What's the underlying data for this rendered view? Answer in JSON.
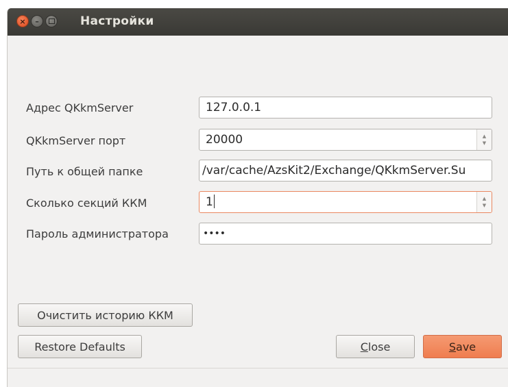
{
  "window": {
    "title": "Настройки",
    "controls": {
      "close": "×",
      "minimize": "–"
    }
  },
  "form": {
    "server_address": {
      "label": "Адрес QKkmServer",
      "value": "127.0.0.1"
    },
    "server_port": {
      "label": "QKkmServer порт",
      "value": "20000"
    },
    "shared_path": {
      "label": "Путь к общей папке",
      "value": "/var/cache/AzsKit2/Exchange/QKkmServer.Su"
    },
    "kkm_sections": {
      "label": "Сколько секций ККМ",
      "value": "1"
    },
    "admin_password": {
      "label": "Пароль администратора",
      "value": "••••"
    }
  },
  "buttons": {
    "clear_history": "Очистить историю ККМ",
    "restore_defaults": "Restore Defaults",
    "close_first": "C",
    "close_rest": "lose",
    "save_first": "S",
    "save_rest": "ave"
  },
  "spin_glyphs": {
    "up": "▲",
    "down": "▼"
  },
  "colors": {
    "titlebar": "#3c3b37",
    "title_text": "#e6e4dd",
    "close_button": "#e9612f",
    "focus_border": "#e9865f",
    "save_button": "#f28a5e",
    "dialog_bg": "#f2f1f0"
  }
}
